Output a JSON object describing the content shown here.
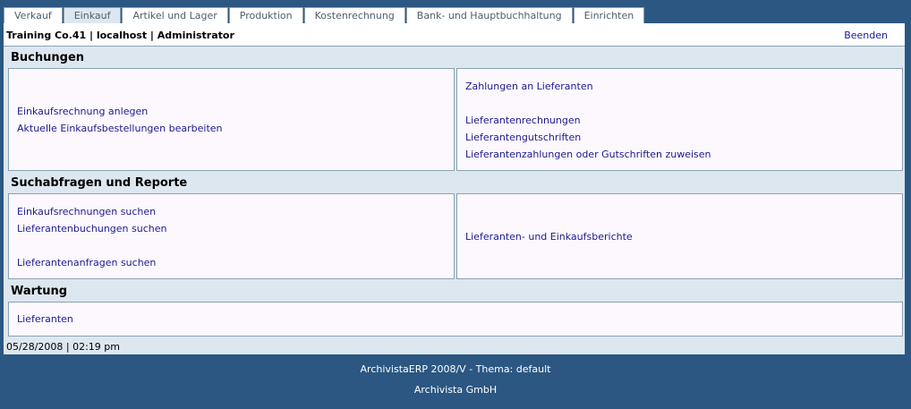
{
  "tabs": [
    {
      "label": "Verkauf"
    },
    {
      "label": "Einkauf",
      "active": true
    },
    {
      "label": "Artikel und Lager"
    },
    {
      "label": "Produktion"
    },
    {
      "label": "Kostenrechnung"
    },
    {
      "label": "Bank- und Hauptbuchhaltung"
    },
    {
      "label": "Einrichten"
    }
  ],
  "header": {
    "company_info": "Training Co.41 | localhost | Administrator",
    "logout": "Beenden"
  },
  "sections": {
    "buchungen": {
      "title": "Buchungen",
      "left_links": [
        "Einkaufsrechnung anlegen",
        "Aktuelle Einkaufsbestellungen bearbeiten"
      ],
      "right_links": [
        "Zahlungen an Lieferanten",
        "Lieferantenrechnungen",
        "Lieferantengutschriften",
        "Lieferantenzahlungen oder Gutschriften zuweisen"
      ]
    },
    "suchabfragen": {
      "title": "Suchabfragen und Reporte",
      "left_links": [
        "Einkaufsrechnungen suchen",
        "Lieferantenbuchungen suchen",
        "Lieferantenanfragen suchen"
      ],
      "right_links": [
        "Lieferanten- und Einkaufsberichte"
      ]
    },
    "wartung": {
      "title": "Wartung",
      "links": [
        "Lieferanten"
      ]
    }
  },
  "datetime": "05/28/2008 | 02:19 pm",
  "footer": {
    "line1": "ArchivistaERP 2008/V - Thema: default",
    "line2": "Archivista GmbH"
  },
  "colors": {
    "background": "#2b5782",
    "panel": "#dde7ef",
    "box": "#fdf8fd",
    "link": "#1a1a8c",
    "border": "#8aa2b5"
  }
}
